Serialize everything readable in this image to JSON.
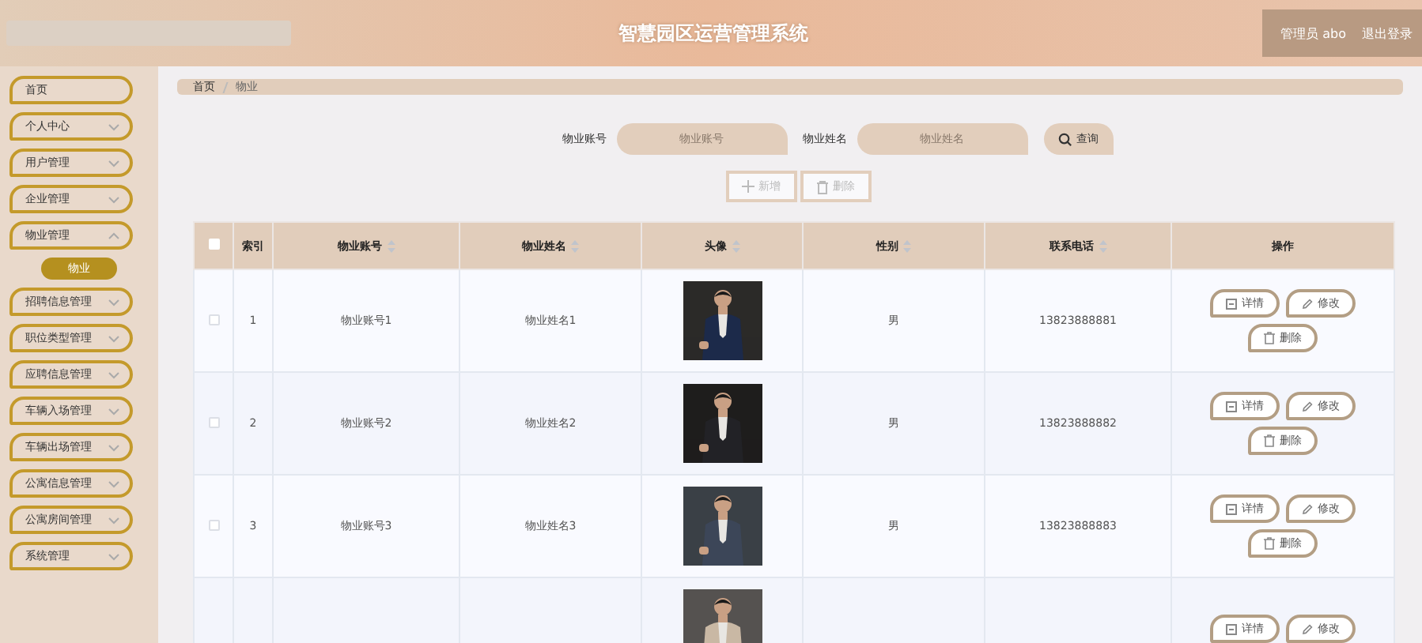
{
  "header": {
    "title": "智慧园区运营管理系统",
    "user": "管理员 abo",
    "logout": "退出登录"
  },
  "sidebar": {
    "items": [
      {
        "label": "首页",
        "expandable": false
      },
      {
        "label": "个人中心",
        "expandable": true,
        "expanded": false
      },
      {
        "label": "用户管理",
        "expandable": true,
        "expanded": false
      },
      {
        "label": "企业管理",
        "expandable": true,
        "expanded": false
      },
      {
        "label": "物业管理",
        "expandable": true,
        "expanded": true,
        "children": [
          {
            "label": "物业",
            "selected": true
          }
        ]
      },
      {
        "label": "招聘信息管理",
        "expandable": true,
        "expanded": false
      },
      {
        "label": "职位类型管理",
        "expandable": true,
        "expanded": false
      },
      {
        "label": "应聘信息管理",
        "expandable": true,
        "expanded": false
      },
      {
        "label": "车辆入场管理",
        "expandable": true,
        "expanded": false
      },
      {
        "label": "车辆出场管理",
        "expandable": true,
        "expanded": false
      },
      {
        "label": "公寓信息管理",
        "expandable": true,
        "expanded": false
      },
      {
        "label": "公寓房间管理",
        "expandable": true,
        "expanded": false
      },
      {
        "label": "系统管理",
        "expandable": true,
        "expanded": false
      }
    ]
  },
  "breadcrumb": [
    "首页",
    "物业"
  ],
  "search": {
    "fields": [
      {
        "label": "物业账号",
        "placeholder": "物业账号"
      },
      {
        "label": "物业姓名",
        "placeholder": "物业姓名"
      }
    ],
    "button": "查询"
  },
  "actions": [
    {
      "kind": "add",
      "label": "新增"
    },
    {
      "kind": "delete",
      "label": "删除"
    }
  ],
  "table": {
    "all_checked": false,
    "columns": [
      {
        "label": "索引",
        "sortable": false
      },
      {
        "label": "物业账号",
        "sortable": true
      },
      {
        "label": "物业姓名",
        "sortable": true
      },
      {
        "label": "头像",
        "sortable": true
      },
      {
        "label": "性别",
        "sortable": true
      },
      {
        "label": "联系电话",
        "sortable": true
      },
      {
        "label": "操作",
        "sortable": false
      }
    ],
    "rows": [
      {
        "checked": false,
        "index": "1",
        "account": "物业账号1",
        "name": "物业姓名1",
        "avatar": {
          "kind": "picture"
        },
        "gender": "男",
        "phone": "13823888881",
        "buttons": [
          {
            "kind": "detail",
            "label": "详情"
          },
          {
            "kind": "edit",
            "label": "修改"
          },
          {
            "kind": "delete",
            "label": "删除"
          }
        ]
      },
      {
        "checked": false,
        "index": "2",
        "account": "物业账号2",
        "name": "物业姓名2",
        "avatar": {
          "kind": "picture"
        },
        "gender": "男",
        "phone": "13823888882",
        "buttons": [
          {
            "kind": "detail",
            "label": "详情"
          },
          {
            "kind": "edit",
            "label": "修改"
          },
          {
            "kind": "delete",
            "label": "删除"
          }
        ]
      },
      {
        "checked": false,
        "index": "3",
        "account": "物业账号3",
        "name": "物业姓名3",
        "avatar": {
          "kind": "picture"
        },
        "gender": "男",
        "phone": "13823888883",
        "buttons": [
          {
            "kind": "detail",
            "label": "详情"
          },
          {
            "kind": "edit",
            "label": "修改"
          },
          {
            "kind": "delete",
            "label": "删除"
          }
        ]
      },
      {
        "avatar": {
          "kind": "picture"
        },
        "buttons": [
          {
            "kind": "detail",
            "label": "详情"
          },
          {
            "kind": "edit",
            "label": "修改"
          }
        ]
      }
    ]
  }
}
